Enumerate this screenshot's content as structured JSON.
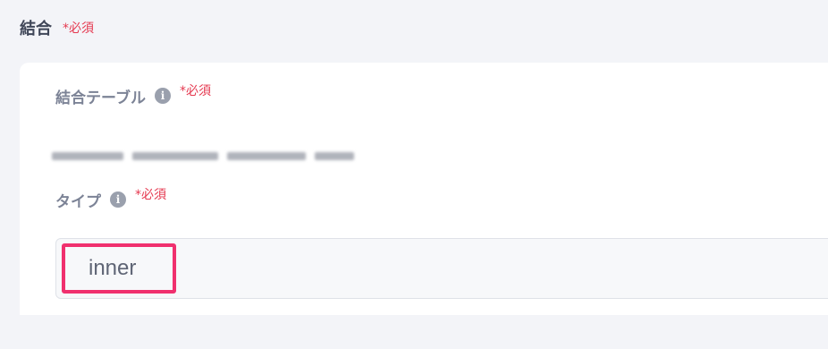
{
  "section": {
    "title": "結合",
    "required_label": "*必須"
  },
  "fields": {
    "join_table": {
      "label": "結合テーブル",
      "required_label": "*必須",
      "info_icon": "info-icon"
    },
    "type": {
      "label": "タイプ",
      "required_label": "*必須",
      "info_icon": "info-icon",
      "value": "inner"
    }
  },
  "colors": {
    "required": "#e53950",
    "highlight": "#f0306e",
    "label": "#7c8396"
  }
}
